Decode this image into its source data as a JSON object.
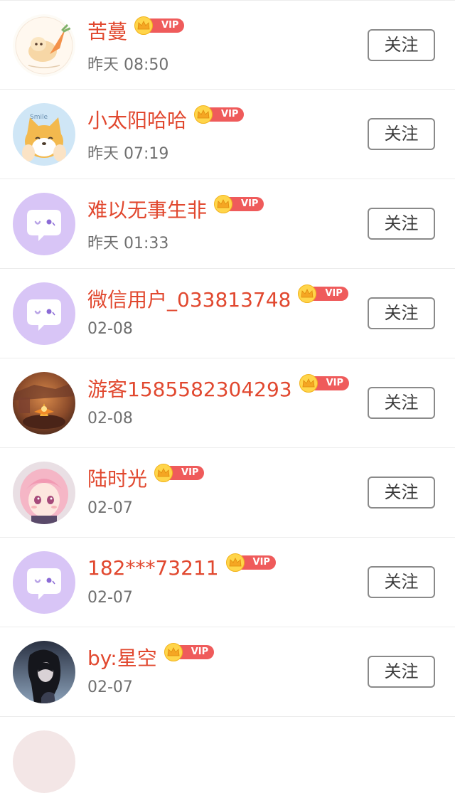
{
  "colors": {
    "name": "#e1482f",
    "time": "#6f6f6f",
    "vip_pill": "#ef5b5b",
    "crown": "#ffd54a",
    "button_border": "#8a8a8a",
    "default_avatar": "#d8c5f6"
  },
  "badge": {
    "vip_label": "VIP",
    "icon": "crown-icon"
  },
  "follow_label": "关注",
  "users": [
    {
      "name": "苦蔓",
      "time": "昨天 08:50",
      "avatar": "carrot-cat-avatar"
    },
    {
      "name": "小太阳哈哈",
      "time": "昨天 07:19",
      "avatar": "shiba-dog-avatar"
    },
    {
      "name": "难以无事生非",
      "time": "昨天 01:33",
      "avatar": "default-chat-avatar"
    },
    {
      "name": "微信用户_033813748",
      "time": "02-08",
      "avatar": "default-chat-avatar"
    },
    {
      "name": "游客1585582304293",
      "time": "02-08",
      "avatar": "game-scene-avatar"
    },
    {
      "name": "陆时光",
      "time": "02-07",
      "avatar": "anime-girl-avatar"
    },
    {
      "name": "182***73211",
      "time": "02-07",
      "avatar": "default-chat-avatar"
    },
    {
      "name": "by:星空",
      "time": "02-07",
      "avatar": "dark-portrait-avatar"
    }
  ]
}
